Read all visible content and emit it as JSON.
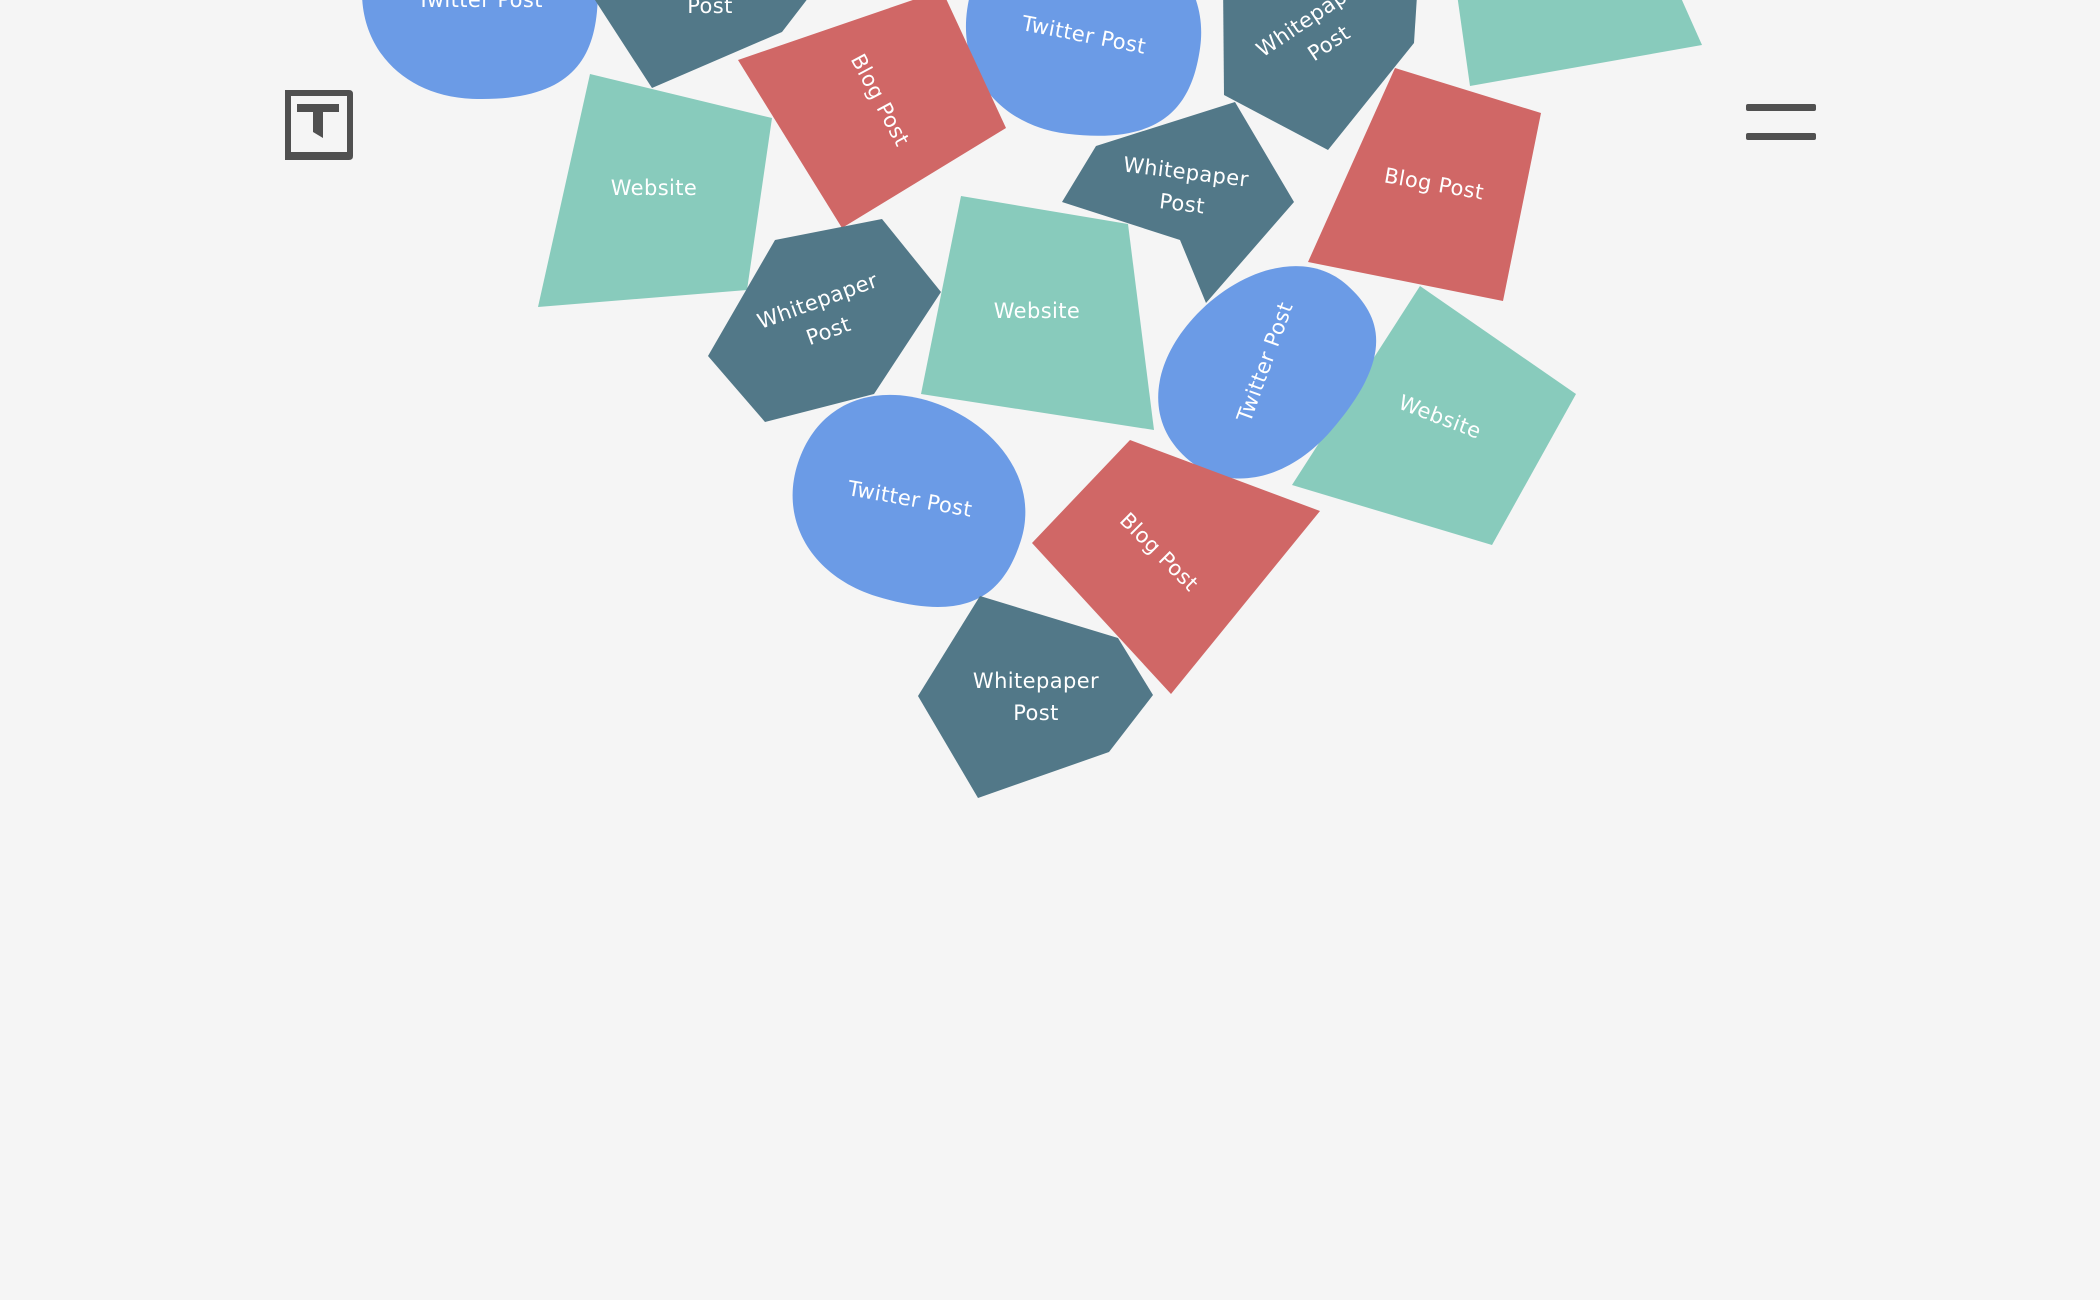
{
  "header": {
    "logo_icon": "t-logo-icon",
    "menu_icon": "hamburger-menu-icon"
  },
  "colors": {
    "background": "#f5f5f5",
    "twitter_post": "#6b9be6",
    "whitepaper_post": "#527888",
    "blog_post": "#d06766",
    "website": "#88cbbc",
    "icon": "#505050"
  },
  "shapes": [
    {
      "kind": "twitter_post",
      "lines": [
        "Twitter Post"
      ]
    },
    {
      "kind": "whitepaper_post",
      "lines": [
        "Post"
      ]
    },
    {
      "kind": "twitter_post",
      "lines": [
        "Twitter Post"
      ]
    },
    {
      "kind": "whitepaper_post",
      "lines": [
        "Whitepaper",
        "Post"
      ]
    },
    {
      "kind": "website",
      "lines": []
    },
    {
      "kind": "blog_post",
      "lines": [
        "Blog Post"
      ]
    },
    {
      "kind": "website",
      "lines": [
        "Website"
      ]
    },
    {
      "kind": "whitepaper_post",
      "lines": [
        "Whitepaper",
        "Post"
      ]
    },
    {
      "kind": "blog_post",
      "lines": [
        "Blog Post"
      ]
    },
    {
      "kind": "whitepaper_post",
      "lines": [
        "Whitepaper",
        "Post"
      ]
    },
    {
      "kind": "website",
      "lines": [
        "Website"
      ]
    },
    {
      "kind": "website",
      "lines": [
        "Website"
      ]
    },
    {
      "kind": "twitter_post",
      "lines": [
        "Twitter Post"
      ]
    },
    {
      "kind": "twitter_post",
      "lines": [
        "Twitter Post"
      ]
    },
    {
      "kind": "blog_post",
      "lines": [
        "Blog Post"
      ]
    },
    {
      "kind": "whitepaper_post",
      "lines": [
        "Whitepaper",
        "Post"
      ]
    }
  ]
}
